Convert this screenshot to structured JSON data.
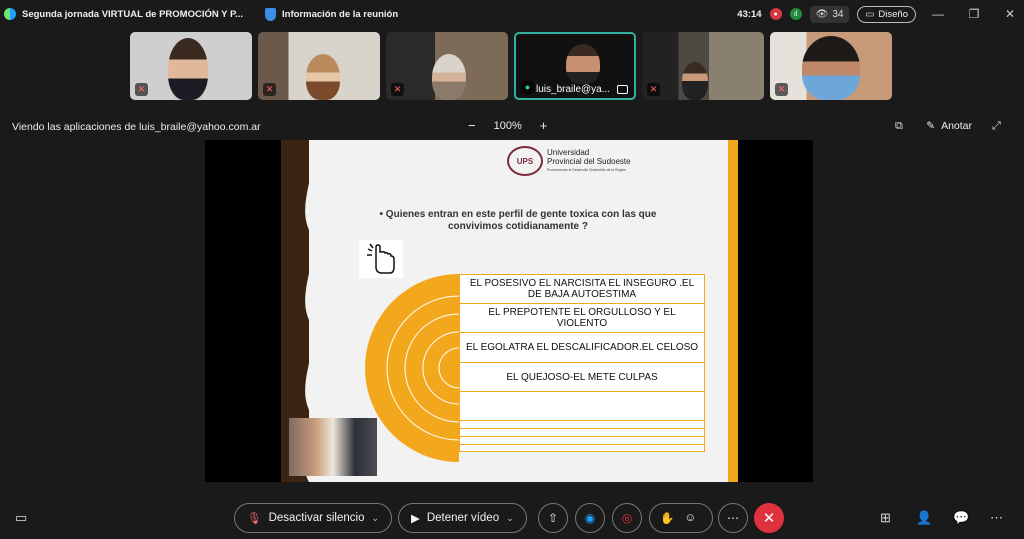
{
  "titlebar": {
    "app_title": "Segunda jornada VIRTUAL de PROMOCIÓN Y P...",
    "info_label": "Información de la reunión",
    "timer": "43:14",
    "participants_count": "34",
    "layout_label": "Diseño",
    "minimize": "—",
    "restore": "❐",
    "close": "✕"
  },
  "participants": [
    {
      "name": "",
      "muted": true
    },
    {
      "name": "",
      "muted": true
    },
    {
      "name": "",
      "muted": true
    },
    {
      "name": "luis_braile@ya...",
      "muted": false,
      "active": true
    },
    {
      "name": "",
      "muted": true
    },
    {
      "name": "",
      "muted": true
    }
  ],
  "share_bar": {
    "viewing_text": "Viendo las aplicaciones de luis_braile@yahoo.com.ar",
    "zoom_out": "−",
    "zoom_level": "100%",
    "zoom_in": "+",
    "annotate_label": "Anotar"
  },
  "slide": {
    "logo_line1": "Universidad",
    "logo_line2": "Provincial del Sudoeste",
    "logo_tagline": "Promoviendo el Desarrollo Sostenible de la Región",
    "logo_mark": "UPS",
    "bullet": "•  Quienes entran en este perfil  de gente toxica con las que convivimos cotidianamente  ?",
    "items": [
      "EL POSESIVO EL NARCISITA EL INSEGURO .EL DE BAJA AUTOESTIMA",
      "EL PREPOTENTE EL ORGULLOSO Y EL VIOLENTO",
      "EL EGOLATRA EL DESCALIFICADOR.EL CELOSO",
      "EL QUEJOSO-EL METE CULPAS",
      "",
      "",
      "",
      "",
      ""
    ]
  },
  "bottom": {
    "mute_label": "Desactivar silencio",
    "video_label": "Detener vídeo"
  },
  "colors": {
    "accent_orange": "#f2a71d",
    "brown": "#3b2512",
    "end_call": "#e0323d",
    "active_tile": "#2fb3a0"
  }
}
